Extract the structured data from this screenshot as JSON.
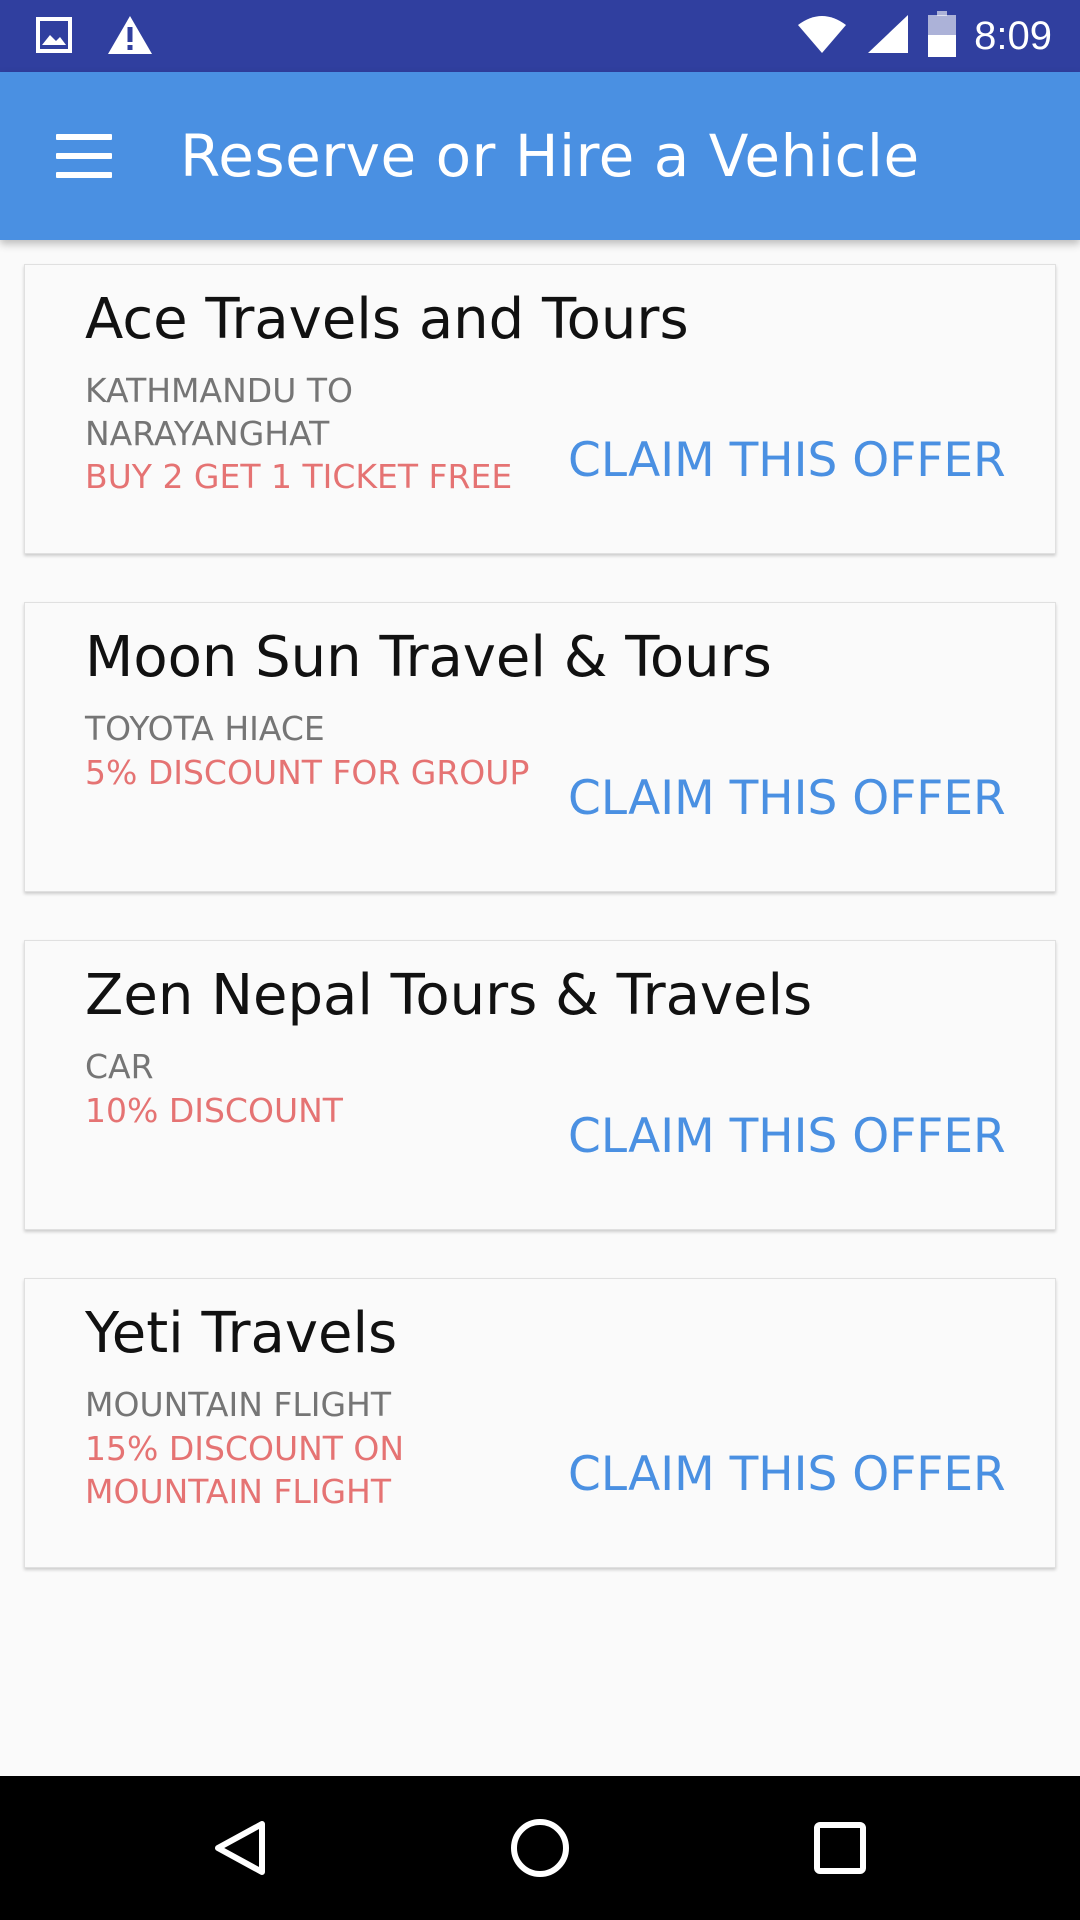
{
  "status_bar": {
    "time": "8:09",
    "left_icons": [
      "image-icon",
      "warning-icon"
    ],
    "right_icons": [
      "wifi-icon",
      "signal-icon",
      "battery-icon"
    ]
  },
  "app_bar": {
    "title": "Reserve or Hire a Vehicle",
    "menu_icon": "menu-icon"
  },
  "offers": [
    {
      "name": "Ace Travels and Tours",
      "subtitle": "KATHMANDU TO NARAYANGHAT",
      "offer": "BUY 2 GET 1 TICKET FREE",
      "action": "CLAIM THIS OFFER"
    },
    {
      "name": "Moon Sun Travel & Tours",
      "subtitle": "TOYOTA HIACE",
      "offer": "5% DISCOUNT FOR GROUP",
      "action": "CLAIM THIS OFFER"
    },
    {
      "name": "Zen Nepal Tours & Travels",
      "subtitle": "CAR",
      "offer": "10% DISCOUNT",
      "action": "CLAIM THIS OFFER"
    },
    {
      "name": "Yeti Travels",
      "subtitle": "MOUNTAIN FLIGHT",
      "offer": "15% DISCOUNT ON MOUNTAIN FLIGHT",
      "action": "CLAIM THIS OFFER"
    }
  ],
  "colors": {
    "status_bar": "#303f9f",
    "app_bar": "#4a90e2",
    "offer_text": "#e57373",
    "action_text": "#4a90e2"
  },
  "nav_bar": {
    "icons": [
      "back-icon",
      "home-icon",
      "recents-icon"
    ]
  }
}
